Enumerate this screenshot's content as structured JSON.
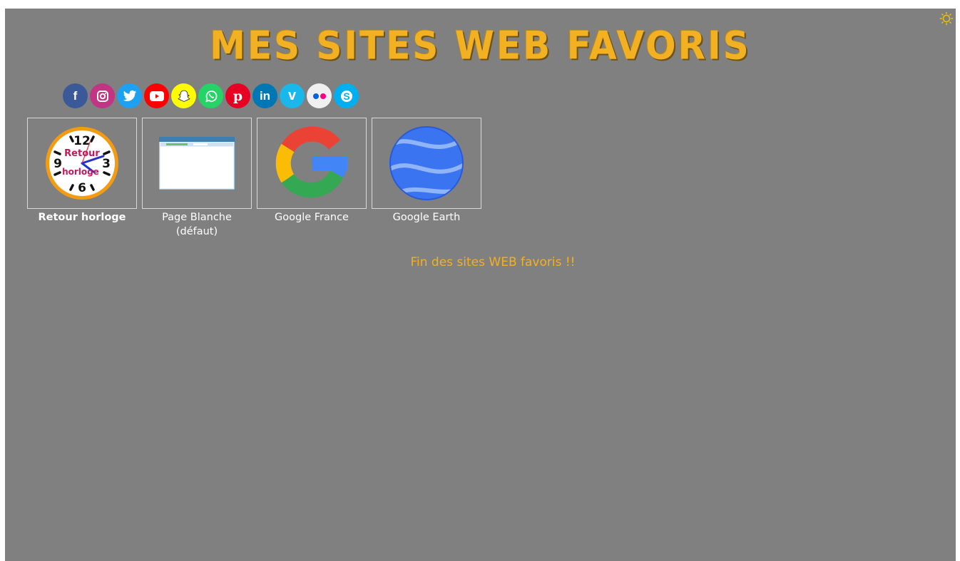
{
  "page": {
    "title": "MES SITES WEB FAVORIS",
    "end_message": "Fin des sites WEB favoris !!"
  },
  "settings": {
    "icon": "gear-icon",
    "color": "#f2c400"
  },
  "social": [
    {
      "name": "facebook",
      "icon": "facebook-icon",
      "glyph": "f",
      "color": "#3b5998"
    },
    {
      "name": "instagram",
      "icon": "instagram-icon",
      "glyph": "",
      "color": "#c13584"
    },
    {
      "name": "twitter",
      "icon": "twitter-icon",
      "glyph": "",
      "color": "#1da1f2"
    },
    {
      "name": "youtube",
      "icon": "youtube-icon",
      "glyph": "",
      "color": "#ff0000"
    },
    {
      "name": "snapchat",
      "icon": "snapchat-icon",
      "glyph": "",
      "color": "#fffc00"
    },
    {
      "name": "whatsapp",
      "icon": "whatsapp-icon",
      "glyph": "",
      "color": "#25d366"
    },
    {
      "name": "pinterest",
      "icon": "pinterest-icon",
      "glyph": "p",
      "color": "#e60023"
    },
    {
      "name": "linkedin",
      "icon": "linkedin-icon",
      "glyph": "in",
      "color": "#0077b5"
    },
    {
      "name": "vimeo",
      "icon": "vimeo-icon",
      "glyph": "v",
      "color": "#1ab7ea"
    },
    {
      "name": "flickr",
      "icon": "flickr-icon",
      "glyph": "",
      "color": "#f0f0f0"
    },
    {
      "name": "skype",
      "icon": "skype-icon",
      "glyph": "S",
      "color": "#00aff0"
    }
  ],
  "tiles": [
    {
      "label": "Retour horloge",
      "icon": "clock-icon",
      "clock_numbers": [
        "12",
        "3",
        "6",
        "9"
      ],
      "clock_text_1": "Retour",
      "clock_text_2": "horloge"
    },
    {
      "label": "Page Blanche (défaut)",
      "icon": "blank-page-icon"
    },
    {
      "label": "Google France",
      "icon": "google-logo-icon"
    },
    {
      "label": "Google Earth",
      "icon": "google-earth-icon"
    }
  ],
  "colors": {
    "background": "#808080",
    "accent": "#f2b023",
    "tile_border": "#d9d9d9",
    "text": "#ffffff"
  }
}
